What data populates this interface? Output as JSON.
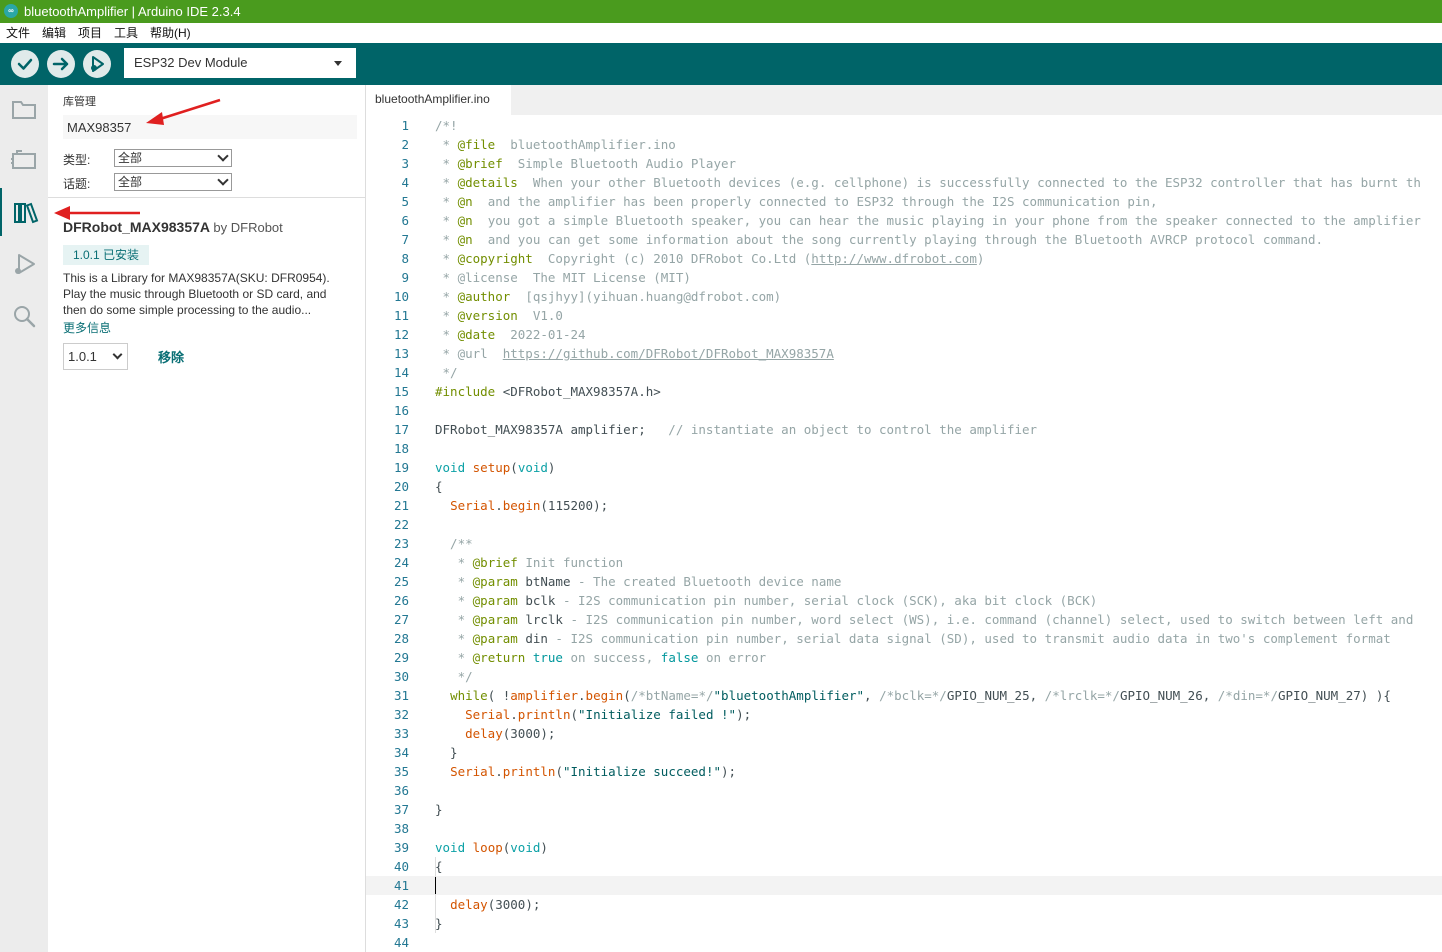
{
  "window": {
    "title": "bluetoothAmplifier | Arduino IDE 2.3.4",
    "icon_text": "∞"
  },
  "menu": [
    "文件",
    "编辑",
    "项目",
    "工具",
    "帮助(H)"
  ],
  "toolbar": {
    "board": "ESP32 Dev Module",
    "buttons": [
      "verify",
      "upload",
      "debug"
    ]
  },
  "activity": [
    "sketchbook",
    "boards-manager",
    "library-manager",
    "debug",
    "search"
  ],
  "library_manager": {
    "title": "库管理",
    "search_value": "MAX98357",
    "type_label": "类型:",
    "type_value": "全部",
    "topic_label": "话题:",
    "topic_value": "全部",
    "library": {
      "name": "DFRobot_MAX98357A",
      "by": "by DFRobot",
      "badge": "1.0.1 已安装",
      "description": "This is a Library for MAX98357A(SKU: DFR0954). Play the music through Bluetooth or SD card, and then do some simple processing to the audio...",
      "more_info": "更多信息",
      "version": "1.0.1",
      "remove": "移除"
    }
  },
  "editor": {
    "tab": "bluetoothAmplifier.ino",
    "current_line": 41,
    "lines": [
      [
        [
          "c",
          "/*!"
        ]
      ],
      [
        [
          "c",
          " * "
        ],
        [
          "t",
          "@file"
        ],
        [
          "c",
          "  bluetoothAmplifier.ino"
        ]
      ],
      [
        [
          "c",
          " * "
        ],
        [
          "t",
          "@brief"
        ],
        [
          "c",
          "  Simple Bluetooth Audio Player"
        ]
      ],
      [
        [
          "c",
          " * "
        ],
        [
          "t",
          "@details"
        ],
        [
          "c",
          "  When your other Bluetooth devices (e.g. cellphone) is successfully connected to the ESP32 controller that has burnt th"
        ]
      ],
      [
        [
          "c",
          " * "
        ],
        [
          "t",
          "@n"
        ],
        [
          "c",
          "  and the amplifier has been properly connected to ESP32 through the I2S communication pin,"
        ]
      ],
      [
        [
          "c",
          " * "
        ],
        [
          "t",
          "@n"
        ],
        [
          "c",
          "  you got a simple Bluetooth speaker, you can hear the music playing in your phone from the speaker connected to the amplifier"
        ]
      ],
      [
        [
          "c",
          " * "
        ],
        [
          "t",
          "@n"
        ],
        [
          "c",
          "  and you can get some information about the song currently playing through the Bluetooth AVRCP protocol command."
        ]
      ],
      [
        [
          "c",
          " * "
        ],
        [
          "t",
          "@copyright"
        ],
        [
          "c",
          "  Copyright (c) 2010 DFRobot Co.Ltd ("
        ],
        [
          "u",
          "http://www.dfrobot.com"
        ],
        [
          "c",
          ")"
        ]
      ],
      [
        [
          "c",
          " * @license  The MIT License (MIT)"
        ]
      ],
      [
        [
          "c",
          " * "
        ],
        [
          "t",
          "@author"
        ],
        [
          "c",
          "  [qsjhyy](yihuan.huang@dfrobot.com)"
        ]
      ],
      [
        [
          "c",
          " * "
        ],
        [
          "t",
          "@version"
        ],
        [
          "c",
          "  V1.0"
        ]
      ],
      [
        [
          "c",
          " * "
        ],
        [
          "t",
          "@date"
        ],
        [
          "c",
          "  2022-01-24"
        ]
      ],
      [
        [
          "c",
          " * @url  "
        ],
        [
          "u",
          "https://github.com/DFRobot/DFRobot_MAX98357A"
        ]
      ],
      [
        [
          "c",
          " */"
        ]
      ],
      [
        [
          "t",
          "#include"
        ],
        [
          "p",
          " <DFRobot_MAX98357A.h>"
        ]
      ],
      [],
      [
        [
          "p",
          "DFRobot_MAX98357A amplifier;   "
        ],
        [
          "c",
          "// instantiate an object to control the amplifier"
        ]
      ],
      [],
      [
        [
          "k",
          "void"
        ],
        [
          "p",
          " "
        ],
        [
          "f",
          "setup"
        ],
        [
          "p",
          "("
        ],
        [
          "k",
          "void"
        ],
        [
          "p",
          ")"
        ]
      ],
      [
        [
          "p",
          "{"
        ]
      ],
      [
        [
          "p",
          "  "
        ],
        [
          "f",
          "Serial"
        ],
        [
          "p",
          "."
        ],
        [
          "f",
          "begin"
        ],
        [
          "p",
          "(115200);"
        ]
      ],
      [],
      [
        [
          "c",
          "  /**"
        ]
      ],
      [
        [
          "c",
          "   * "
        ],
        [
          "t",
          "@brief"
        ],
        [
          "c",
          " Init function"
        ]
      ],
      [
        [
          "c",
          "   * "
        ],
        [
          "t",
          "@param"
        ],
        [
          "p",
          " btName"
        ],
        [
          "c",
          " - The created Bluetooth device name"
        ]
      ],
      [
        [
          "c",
          "   * "
        ],
        [
          "t",
          "@param"
        ],
        [
          "p",
          " bclk"
        ],
        [
          "c",
          " - I2S communication pin number, serial clock (SCK), aka bit clock (BCK)"
        ]
      ],
      [
        [
          "c",
          "   * "
        ],
        [
          "t",
          "@param"
        ],
        [
          "p",
          " lrclk"
        ],
        [
          "c",
          " - I2S communication pin number, word select (WS), i.e. command (channel) select, used to switch between left and"
        ]
      ],
      [
        [
          "c",
          "   * "
        ],
        [
          "t",
          "@param"
        ],
        [
          "p",
          " din"
        ],
        [
          "c",
          " - I2S communication pin number, serial data signal (SD), used to transmit audio data in two's complement format"
        ]
      ],
      [
        [
          "c",
          "   * "
        ],
        [
          "t",
          "@return"
        ],
        [
          "m",
          " true"
        ],
        [
          "c",
          " on success,"
        ],
        [
          "m",
          " false"
        ],
        [
          "c",
          " on error"
        ]
      ],
      [
        [
          "c",
          "   */"
        ]
      ],
      [
        [
          "p",
          "  "
        ],
        [
          "t",
          "while"
        ],
        [
          "p",
          "( !"
        ],
        [
          "f",
          "amplifier"
        ],
        [
          "p",
          "."
        ],
        [
          "f",
          "begin"
        ],
        [
          "p",
          "("
        ],
        [
          "c",
          "/*btName=*/"
        ],
        [
          "s",
          "\"bluetoothAmplifier\""
        ],
        [
          "p",
          ", "
        ],
        [
          "c",
          "/*bclk=*/"
        ],
        [
          "p",
          "GPIO_NUM_25, "
        ],
        [
          "c",
          "/*lrclk=*/"
        ],
        [
          "p",
          "GPIO_NUM_26, "
        ],
        [
          "c",
          "/*din=*/"
        ],
        [
          "p",
          "GPIO_NUM_27) ){"
        ]
      ],
      [
        [
          "p",
          "    "
        ],
        [
          "f",
          "Serial"
        ],
        [
          "p",
          "."
        ],
        [
          "f",
          "println"
        ],
        [
          "p",
          "("
        ],
        [
          "s",
          "\"Initialize failed !\""
        ],
        [
          "p",
          ");"
        ]
      ],
      [
        [
          "p",
          "    "
        ],
        [
          "f",
          "delay"
        ],
        [
          "p",
          "(3000);"
        ]
      ],
      [
        [
          "p",
          "  }"
        ]
      ],
      [
        [
          "p",
          "  "
        ],
        [
          "f",
          "Serial"
        ],
        [
          "p",
          "."
        ],
        [
          "f",
          "println"
        ],
        [
          "p",
          "("
        ],
        [
          "s",
          "\"Initialize succeed!\""
        ],
        [
          "p",
          ");"
        ]
      ],
      [],
      [
        [
          "p",
          "}"
        ]
      ],
      [],
      [
        [
          "k",
          "void"
        ],
        [
          "p",
          " "
        ],
        [
          "f",
          "loop"
        ],
        [
          "p",
          "("
        ],
        [
          "k",
          "void"
        ],
        [
          "p",
          ")"
        ]
      ],
      [
        [
          "p",
          "{"
        ]
      ],
      [],
      [
        [
          "p",
          "  "
        ],
        [
          "f",
          "delay"
        ],
        [
          "p",
          "(3000);"
        ]
      ],
      [
        [
          "p",
          "}"
        ]
      ],
      []
    ]
  }
}
